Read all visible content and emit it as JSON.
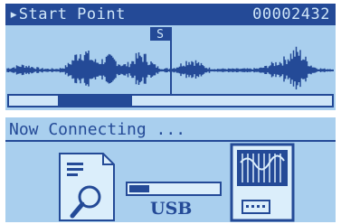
{
  "waveform_screen": {
    "title": "Start Point",
    "counter": "00002432",
    "marker_label": "S",
    "scroll_position": 0.2
  },
  "connection_screen": {
    "status_text": "Now Connecting ...",
    "usb_label": "USB",
    "progress": 0.22,
    "icons": [
      "file-search-icon",
      "usb-cable-icon",
      "memory-card-icon"
    ]
  },
  "colors": {
    "lcd_background": "#a9cfee",
    "lcd_foreground": "#244a97",
    "header_text": "#cfe6f8"
  }
}
